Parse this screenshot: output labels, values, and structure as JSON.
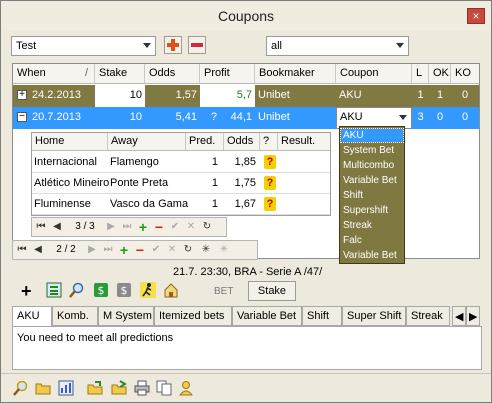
{
  "window": {
    "title": "Coupons",
    "close_icon": "×"
  },
  "filters": {
    "group_value": "Test",
    "status_value": "all"
  },
  "grid": {
    "columns": [
      "When",
      "Stake",
      "Odds",
      "Profit",
      "Bookmaker",
      "Coupon",
      "L",
      "OK",
      "KO"
    ],
    "sort_indicator": "/",
    "rows": [
      {
        "expand": "+",
        "when": "24.2.2013",
        "stake": "10",
        "odds": "1,57",
        "q": "",
        "profit": "5,7",
        "bookmaker": "Unibet",
        "coupon": "AKU",
        "l": "1",
        "ok": "1",
        "ko": "0"
      },
      {
        "expand": "−",
        "when": "20.7.2013",
        "stake": "10",
        "odds": "5,41",
        "q": "?",
        "profit": "44,1",
        "bookmaker": "Unibet",
        "coupon": "AKU",
        "l": "3",
        "ok": "0",
        "ko": "0"
      }
    ]
  },
  "subgrid": {
    "columns": [
      "Home",
      "Away",
      "Pred.",
      "Odds",
      "?",
      "Result."
    ],
    "rows": [
      {
        "home": "Internacional",
        "away": "Flamengo",
        "pred": "1",
        "odds": "1,85",
        "q": "?"
      },
      {
        "home": "Atlético Mineiro",
        "away": "Ponte Preta",
        "pred": "1",
        "odds": "1,75",
        "q": "?"
      },
      {
        "home": "Fluminense",
        "away": "Vasco da Gama",
        "pred": "1",
        "odds": "1,67",
        "q": "?"
      }
    ],
    "pager": "3 / 3"
  },
  "outer_pager": "2 / 2",
  "dropdown": {
    "items": [
      "AKU",
      "System Bet",
      "Multicombo",
      "Variable Bet",
      "Shift",
      "Supershift",
      "Streak",
      "Falc",
      "Variable Bet"
    ],
    "selected_index": 0
  },
  "info": {
    "match": "21.7. 23:30, BRA - Serie A /47/",
    "bet_label": "BET",
    "stake_button": "Stake"
  },
  "tabs": [
    "AKU",
    "Komb.",
    "M System",
    "Itemized bets",
    "Variable Bet",
    "Shift",
    "Super Shift",
    "Streak"
  ],
  "tab_content": "You need to meet all predictions",
  "colors": {
    "row_selected": "#3399ff",
    "row_olive": "#817942",
    "profit_green": "#1a8a1a",
    "dropdown_bg": "#807841"
  }
}
